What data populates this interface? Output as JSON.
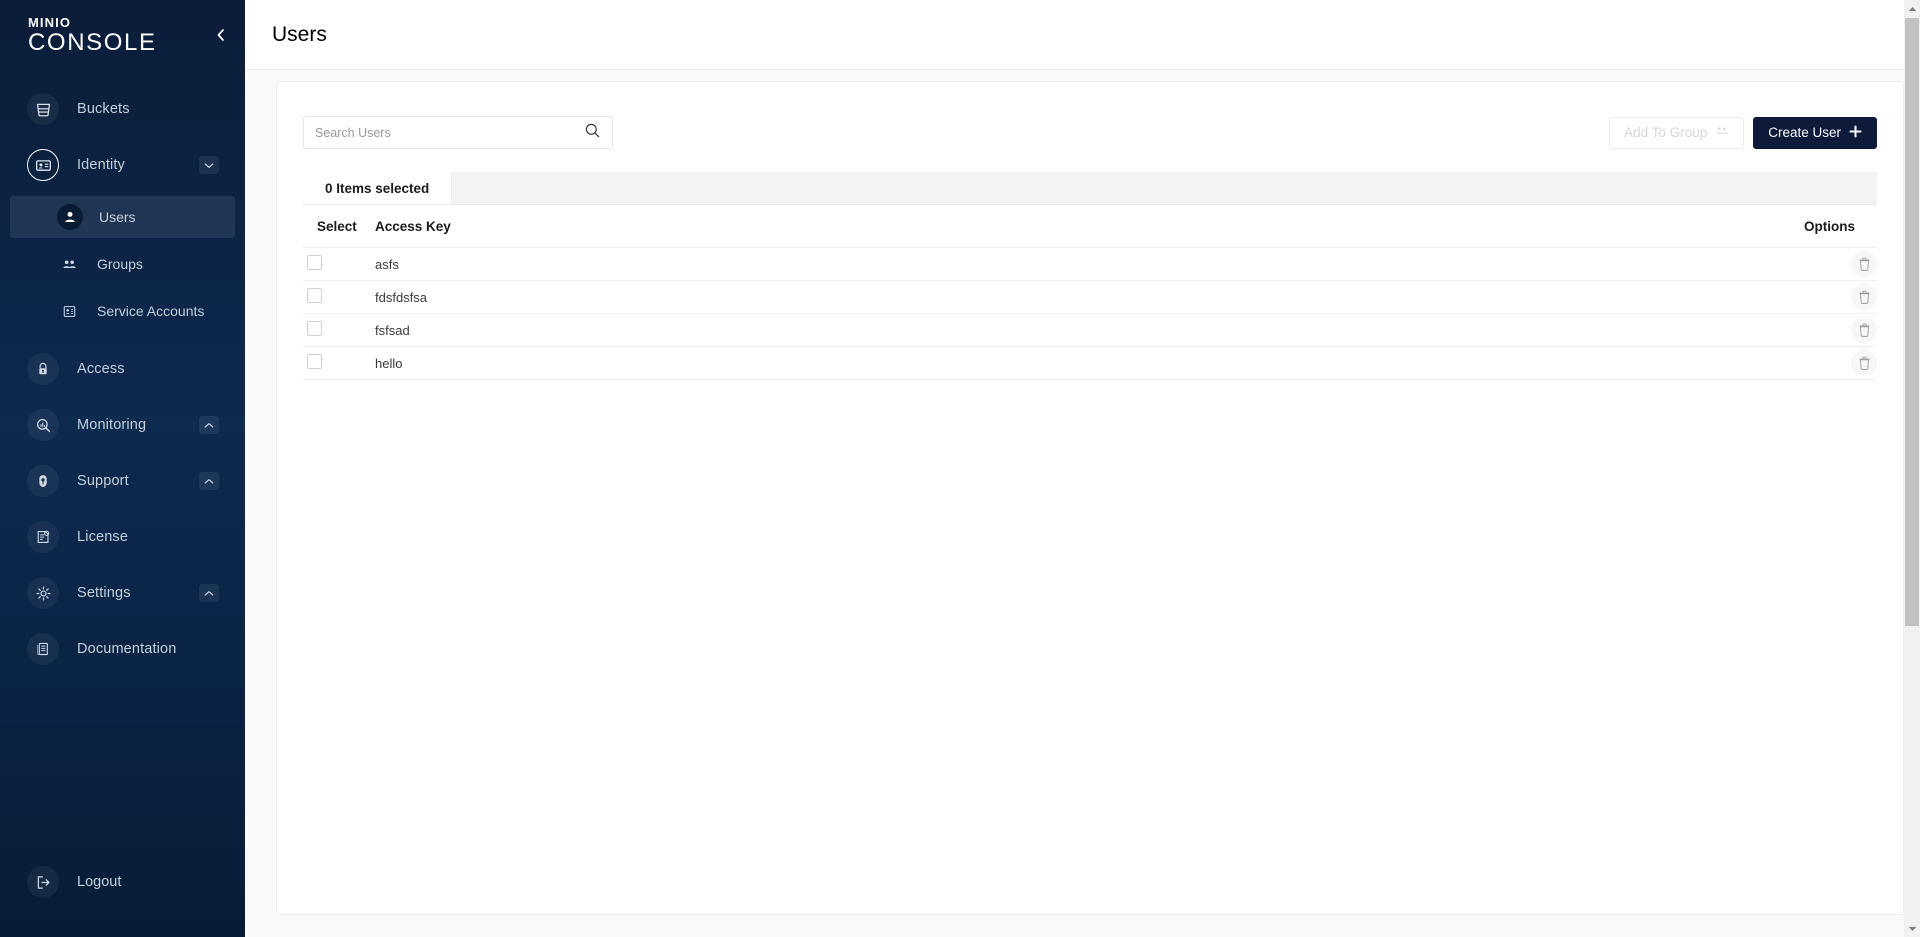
{
  "brand": {
    "line1": "MINIO",
    "line2": "CONSOLE",
    "collapse_icon": "chevron-left-icon",
    "sidebar_bg": "#0d2a4f"
  },
  "sidebar": {
    "items": [
      {
        "label": "Buckets",
        "icon": "bucket-icon",
        "type": "parent",
        "active": false,
        "chevron": ""
      },
      {
        "label": "Identity",
        "icon": "identity-card-icon",
        "type": "parent",
        "active": true,
        "chevron": "chevron-down-icon"
      },
      {
        "label": "Users",
        "icon": "user-icon",
        "type": "child",
        "selected": true
      },
      {
        "label": "Groups",
        "icon": "users-group-icon",
        "type": "child",
        "selected": false
      },
      {
        "label": "Service Accounts",
        "icon": "id-badge-icon",
        "type": "child",
        "selected": false
      },
      {
        "label": "Access",
        "icon": "lock-icon",
        "type": "parent",
        "active": false,
        "chevron": ""
      },
      {
        "label": "Monitoring",
        "icon": "magnifier-chart-icon",
        "type": "parent",
        "active": false,
        "chevron": "chevron-up-icon"
      },
      {
        "label": "Support",
        "icon": "support-hand-icon",
        "type": "parent",
        "active": false,
        "chevron": "chevron-up-icon"
      },
      {
        "label": "License",
        "icon": "license-certificate-icon",
        "type": "parent",
        "active": false,
        "chevron": ""
      },
      {
        "label": "Settings",
        "icon": "gear-icon",
        "type": "parent",
        "active": false,
        "chevron": "chevron-up-icon"
      },
      {
        "label": "Documentation",
        "icon": "book-icon",
        "type": "parent",
        "active": false,
        "chevron": ""
      }
    ],
    "logout": {
      "label": "Logout",
      "icon": "logout-icon"
    }
  },
  "header": {
    "title": "Users"
  },
  "toolbar": {
    "search_placeholder": "Search Users",
    "search_value": "",
    "search_icon": "search-icon",
    "add_to_group_label": "Add To Group",
    "add_to_group_icon": "users-group-icon",
    "add_to_group_disabled": true,
    "create_user_label": "Create User",
    "create_user_icon": "plus-icon",
    "primary_color": "#0d1a3a"
  },
  "table": {
    "selected_tab_label": "0 Items selected",
    "columns": [
      "Select",
      "Access Key",
      "Options"
    ],
    "rows": [
      {
        "access_key": "asfs",
        "checked": false,
        "delete_icon": "trash-icon"
      },
      {
        "access_key": "fdsfdsfsa",
        "checked": false,
        "delete_icon": "trash-icon"
      },
      {
        "access_key": "fsfsad",
        "checked": false,
        "delete_icon": "trash-icon"
      },
      {
        "access_key": "hello",
        "checked": false,
        "delete_icon": "trash-icon"
      }
    ]
  }
}
